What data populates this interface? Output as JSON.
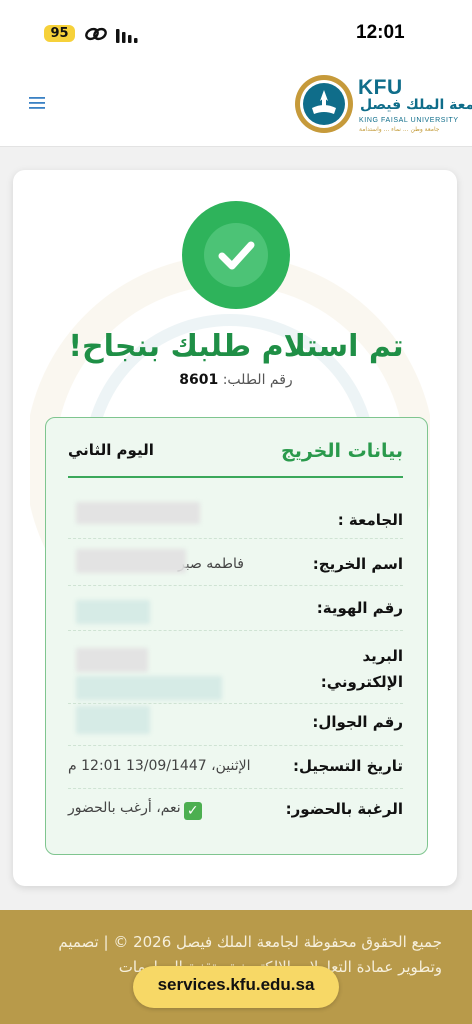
{
  "status_bar": {
    "battery": "95",
    "time": "12:01"
  },
  "header": {
    "logo_abbr": "KFU",
    "logo_arabic": "جامعة الملك فيصل",
    "logo_english": "KING FAISAL UNIVERSITY",
    "logo_tagline": "جامعة وطن ... نماء ... واستدامة"
  },
  "confirmation": {
    "title": "تم استلام طلبك بنجاح!",
    "order_label": "رقم الطلب:",
    "order_number": "8601"
  },
  "graduate": {
    "section_title": "بيانات الخريج",
    "day": "اليوم الثاني",
    "rows": [
      {
        "label": "الجامعة :",
        "value": ""
      },
      {
        "label": "اسم الخريج:",
        "value": "فاطمه صبر"
      },
      {
        "label": "رقم الهوية:",
        "value": ""
      },
      {
        "label": "البريد الإلكتروني:",
        "value": ""
      },
      {
        "label": "رقم الجوال:",
        "value": ""
      },
      {
        "label": "تاريخ التسجيل:",
        "value": "الإثنين، 13/09/1447 12:01 م"
      },
      {
        "label": "الرغبة بالحضور:",
        "value": "نعم، أرغب بالحضور"
      }
    ]
  },
  "footer": {
    "text": "جميع الحقوق محفوظة لجامعة الملك فيصل 2026 © | تصميم وتطوير عمادة التعاملات الإلكترونية وتقنية المعلومات",
    "url": "services.kfu.edu.sa"
  },
  "colors": {
    "success_green": "#1f8f46",
    "brand_teal": "#0f6d8a",
    "footer_gold": "#b89a4a"
  }
}
